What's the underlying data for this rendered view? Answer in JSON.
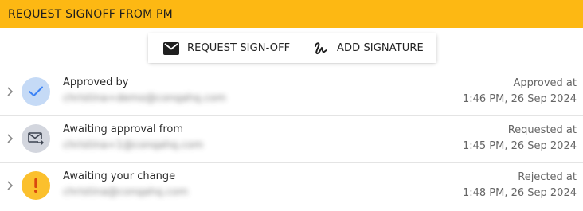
{
  "header": {
    "title": "REQUEST SIGNOFF FROM PM"
  },
  "actions": {
    "request_signoff_label": "REQUEST SIGN-OFF",
    "add_signature_label": "ADD SIGNATURE"
  },
  "colors": {
    "header_bg": "#FDB813",
    "approved_badge_bg": "#C5DAF6",
    "approved_check": "#3B82F6",
    "awaiting_badge_bg": "#D3D6DE",
    "warning_badge_bg": "#FBC02D",
    "warning_mark": "#D9480F"
  },
  "rows": [
    {
      "icon": "check-icon",
      "title": "Approved by",
      "email": "christina+demo@conqahq.com",
      "status_label": "Approved at",
      "status_time": "1:46 PM, 26 Sep 2024"
    },
    {
      "icon": "mail-forward-icon",
      "title": "Awaiting approval from",
      "email": "christina+1@conqahq.com",
      "status_label": "Requested at",
      "status_time": "1:45 PM, 26 Sep 2024"
    },
    {
      "icon": "exclamation-icon",
      "title": "Awaiting your change",
      "email": "christina@conqahq.com",
      "status_label": "Rejected at",
      "status_time": "1:48 PM, 26 Sep 2024"
    }
  ]
}
